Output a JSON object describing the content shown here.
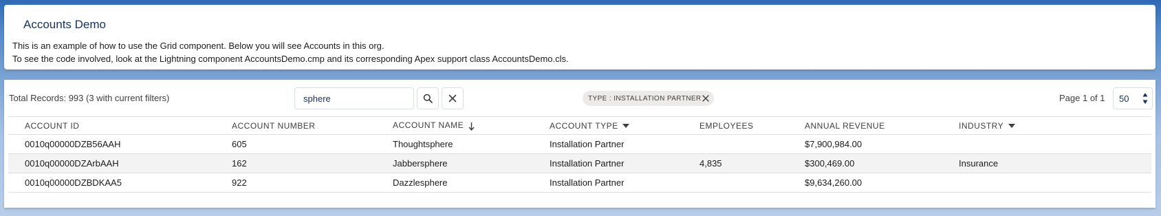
{
  "header": {
    "title": "Accounts Demo",
    "description_line1": "This is an example of how to use the Grid component. Below you will see Accounts in this org.",
    "description_line2": "To see the code involved, look at the Lightning component AccountsDemo.cmp and its corresponding Apex support class AccountsDemo.cls."
  },
  "toolbar": {
    "total_records": "Total Records: 993 (3 with current filters)",
    "search_value": "sphere",
    "search_icon": "search-icon",
    "clear_icon": "close-icon",
    "filter_pill_label": "TYPE : INSTALLATION PARTNER",
    "page_info": "Page 1 of 1",
    "page_size": "50"
  },
  "table": {
    "columns": [
      {
        "label": "ACCOUNT ID"
      },
      {
        "label": "ACCOUNT NUMBER"
      },
      {
        "label": "ACCOUNT NAME",
        "indicator": "sort-desc-arrow-icon"
      },
      {
        "label": "ACCOUNT TYPE",
        "indicator": "caret-down-icon"
      },
      {
        "label": "EMPLOYEES"
      },
      {
        "label": "ANNUAL REVENUE"
      },
      {
        "label": "INDUSTRY",
        "indicator": "caret-down-icon"
      }
    ],
    "rows": [
      {
        "account_id": "0010q00000DZB56AAH",
        "account_number": "605",
        "account_name": "Thoughtsphere",
        "account_type": "Installation Partner",
        "employees": "",
        "annual_revenue": "$7,900,984.00",
        "industry": ""
      },
      {
        "account_id": "0010q00000DZArbAAH",
        "account_number": "162",
        "account_name": "Jabbersphere",
        "account_type": "Installation Partner",
        "employees": "4,835",
        "annual_revenue": "$300,469.00",
        "industry": "Insurance"
      },
      {
        "account_id": "0010q00000DZBDKAA5",
        "account_number": "922",
        "account_name": "Dazzlesphere",
        "account_type": "Installation Partner",
        "employees": "",
        "annual_revenue": "$9,634,260.00",
        "industry": ""
      }
    ]
  },
  "colors": {
    "text_primary": "#16325c",
    "border": "#d8dde6",
    "stripe": "#f3f3f3",
    "pill_bg": "#ecebea"
  }
}
